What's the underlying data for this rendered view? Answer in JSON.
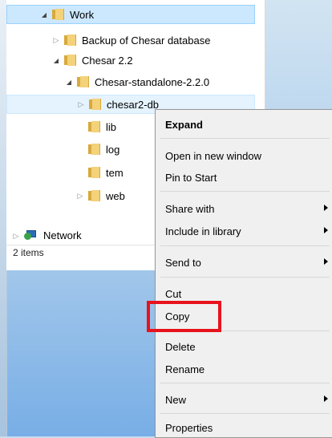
{
  "tree": {
    "items": [
      {
        "label": "Work",
        "arrow": "expanded"
      },
      {
        "label": "Backup of Chesar database",
        "arrow": "collapsed"
      },
      {
        "label": "Chesar 2.2",
        "arrow": "expanded"
      },
      {
        "label": "Chesar-standalone-2.2.0",
        "arrow": "expanded"
      },
      {
        "label": "chesar2-db",
        "arrow": "collapsed"
      },
      {
        "label": "lib",
        "arrow": "none"
      },
      {
        "label": "log",
        "arrow": "none"
      },
      {
        "label": "tem",
        "arrow": "none"
      },
      {
        "label": "web",
        "arrow": "collapsed"
      }
    ],
    "network_label": "Network"
  },
  "status": {
    "items_count": "2 items"
  },
  "context_menu": {
    "expand": "Expand",
    "open_new_window": "Open in new window",
    "pin_to_start": "Pin to Start",
    "share_with": "Share with",
    "include_in_library": "Include in library",
    "send_to": "Send to",
    "cut": "Cut",
    "copy": "Copy",
    "delete": "Delete",
    "rename": "Rename",
    "new": "New",
    "properties": "Properties"
  },
  "colors": {
    "highlight": "#e8121c",
    "selection": "#cce8ff"
  }
}
